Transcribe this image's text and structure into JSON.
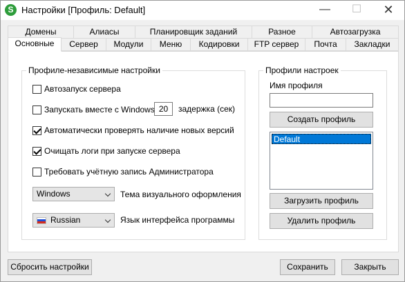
{
  "window": {
    "title": "Настройки [Профиль: Default]",
    "app_icon_letter": "S",
    "minimize_glyph": "—",
    "maximize_glyph": "☐",
    "close_glyph": "✕"
  },
  "tabs_row1": [
    "Домены",
    "Алиасы",
    "Планировщик заданий",
    "Разное",
    "Автозагрузка"
  ],
  "tabs_row2": [
    "Основные",
    "Сервер",
    "Модули",
    "Меню",
    "Кодировки",
    "FTP сервер",
    "Почта",
    "Закладки"
  ],
  "active_tab": "Основные",
  "independent": {
    "title": "Профиле-независимые настройки",
    "autostart_label": "Автозапуск сервера",
    "autostart_checked": false,
    "with_windows_label": "Запускать вместе с Windows",
    "with_windows_checked": false,
    "delay_value": "20",
    "delay_label": "задержка (сек)",
    "check_updates_label": "Автоматически проверять наличие новых версий",
    "check_updates_checked": true,
    "clear_logs_label": "Очищать логи при запуске сервера",
    "clear_logs_checked": true,
    "require_admin_label": "Требовать учётную запись Администратора",
    "require_admin_checked": false,
    "theme_value": "Windows",
    "theme_label": "Тема визуального оформления",
    "language_value": "Russian",
    "language_label": "Язык интерфейса программы"
  },
  "profiles": {
    "title": "Профили настроек",
    "name_label": "Имя профиля",
    "name_value": "",
    "create_button": "Создать профиль",
    "items": [
      "Default"
    ],
    "load_button": "Загрузить профиль",
    "delete_button": "Удалить профиль"
  },
  "footer": {
    "reset_button": "Сбросить настройки",
    "save_button": "Сохранить",
    "close_button": "Закрыть"
  },
  "colors": {
    "selection": "#0078d7",
    "app_icon": "#2e9d3b"
  }
}
